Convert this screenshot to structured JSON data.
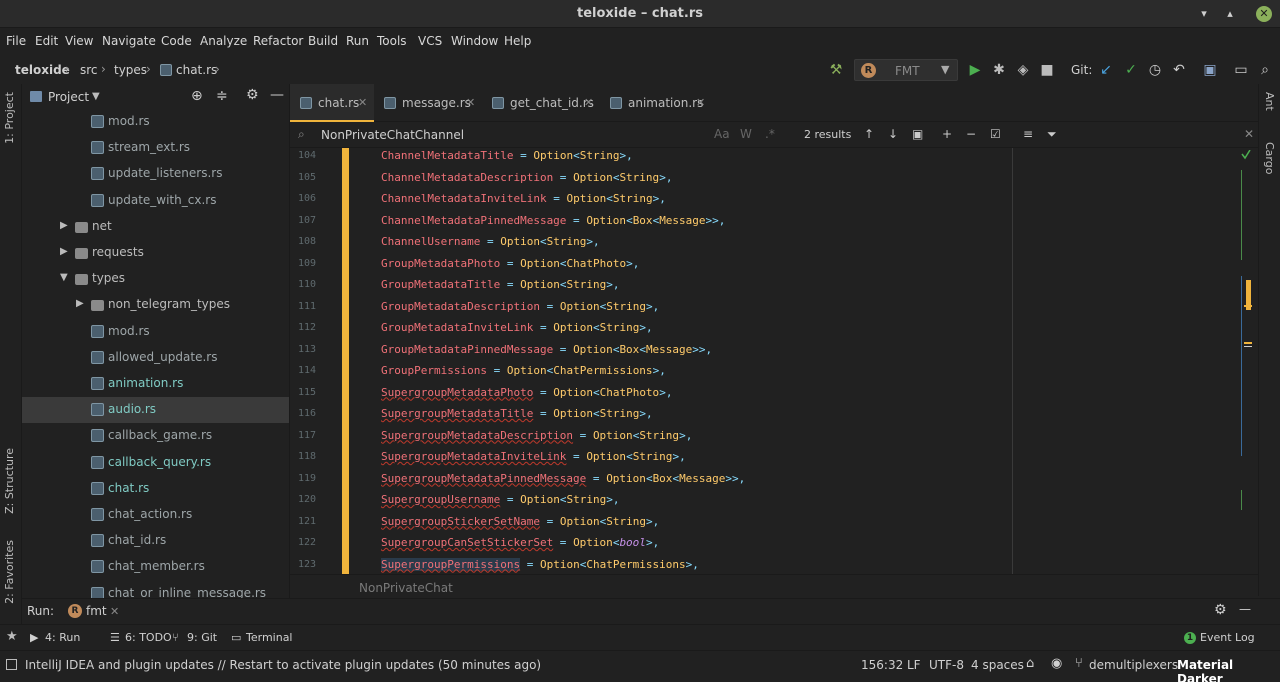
{
  "window": {
    "title": "teloxide – chat.rs"
  },
  "menu": [
    "File",
    "Edit",
    "View",
    "Navigate",
    "Code",
    "Analyze",
    "Refactor",
    "Build",
    "Run",
    "Tools",
    "VCS",
    "Window",
    "Help"
  ],
  "breadcrumb": [
    "teloxide",
    "src",
    "types",
    "chat.rs"
  ],
  "toolbar": {
    "run_config": "FMT",
    "git_label": "Git:"
  },
  "side_tabs": {
    "project": "1: Project",
    "structure": "Z: Structure",
    "favorites": "2: Favorites",
    "ant": "Ant",
    "cargo": "Cargo"
  },
  "project": {
    "title": "Project",
    "rows": [
      {
        "name": "mod.rs",
        "type": "rs",
        "indent": 4,
        "style": "file"
      },
      {
        "name": "stream_ext.rs",
        "type": "rs",
        "indent": 4,
        "style": "file"
      },
      {
        "name": "update_listeners.rs",
        "type": "rs",
        "indent": 4,
        "style": "file"
      },
      {
        "name": "update_with_cx.rs",
        "type": "rs",
        "indent": 4,
        "style": "file"
      },
      {
        "name": "net",
        "type": "dir",
        "indent": 3,
        "style": "plain",
        "arrow": "▶"
      },
      {
        "name": "requests",
        "type": "dir",
        "indent": 3,
        "style": "plain",
        "arrow": "▶"
      },
      {
        "name": "types",
        "type": "dir",
        "indent": 3,
        "style": "plain",
        "arrow": "▼"
      },
      {
        "name": "non_telegram_types",
        "type": "dir",
        "indent": 4,
        "style": "plain",
        "arrow": "▶"
      },
      {
        "name": "mod.rs",
        "type": "rs",
        "indent": 4,
        "style": "file"
      },
      {
        "name": "allowed_update.rs",
        "type": "rs",
        "indent": 4,
        "style": "file"
      },
      {
        "name": "animation.rs",
        "type": "rs",
        "indent": 4,
        "style": "mod"
      },
      {
        "name": "audio.rs",
        "type": "rs",
        "indent": 4,
        "style": "mod",
        "selected": true
      },
      {
        "name": "callback_game.rs",
        "type": "rs",
        "indent": 4,
        "style": "file"
      },
      {
        "name": "callback_query.rs",
        "type": "rs",
        "indent": 4,
        "style": "mod"
      },
      {
        "name": "chat.rs",
        "type": "rs",
        "indent": 4,
        "style": "mod"
      },
      {
        "name": "chat_action.rs",
        "type": "rs",
        "indent": 4,
        "style": "file"
      },
      {
        "name": "chat_id.rs",
        "type": "rs",
        "indent": 4,
        "style": "file"
      },
      {
        "name": "chat_member.rs",
        "type": "rs",
        "indent": 4,
        "style": "file"
      },
      {
        "name": "chat_or_inline_message.rs",
        "type": "rs",
        "indent": 4,
        "style": "file"
      }
    ]
  },
  "tabs": [
    {
      "label": "chat.rs",
      "active": true
    },
    {
      "label": "message.rs",
      "active": false
    },
    {
      "label": "get_chat_id.rs",
      "active": false
    },
    {
      "label": "animation.rs",
      "active": false
    }
  ],
  "search": {
    "query": "NonPrivateChatChannel",
    "results": "2 results",
    "match_case": "Aa",
    "words": "W"
  },
  "code": [
    {
      "n": "104",
      "name": "ChannelMetadataTitle",
      "type": "Option<String>",
      "squig": false
    },
    {
      "n": "105",
      "name": "ChannelMetadataDescription",
      "type": "Option<String>",
      "squig": false
    },
    {
      "n": "106",
      "name": "ChannelMetadataInviteLink",
      "type": "Option<String>",
      "squig": false
    },
    {
      "n": "107",
      "name": "ChannelMetadataPinnedMessage",
      "type": "Option<Box<Message>>",
      "squig": false
    },
    {
      "n": "108",
      "name": "ChannelUsername",
      "type": "Option<String>",
      "squig": false
    },
    {
      "n": "109",
      "name": "GroupMetadataPhoto",
      "type": "Option<ChatPhoto>",
      "squig": false
    },
    {
      "n": "110",
      "name": "GroupMetadataTitle",
      "type": "Option<String>",
      "squig": false
    },
    {
      "n": "111",
      "name": "GroupMetadataDescription",
      "type": "Option<String>",
      "squig": false
    },
    {
      "n": "112",
      "name": "GroupMetadataInviteLink",
      "type": "Option<String>",
      "squig": false
    },
    {
      "n": "113",
      "name": "GroupMetadataPinnedMessage",
      "type": "Option<Box<Message>>",
      "squig": false
    },
    {
      "n": "114",
      "name": "GroupPermissions",
      "type": "Option<ChatPermissions>",
      "squig": false
    },
    {
      "n": "115",
      "name": "SupergroupMetadataPhoto",
      "type": "Option<ChatPhoto>",
      "squig": true
    },
    {
      "n": "116",
      "name": "SupergroupMetadataTitle",
      "type": "Option<String>",
      "squig": true
    },
    {
      "n": "117",
      "name": "SupergroupMetadataDescription",
      "type": "Option<String>",
      "squig": true
    },
    {
      "n": "118",
      "name": "SupergroupMetadataInviteLink",
      "type": "Option<String>",
      "squig": true
    },
    {
      "n": "119",
      "name": "SupergroupMetadataPinnedMessage",
      "type": "Option<Box<Message>>",
      "squig": true
    },
    {
      "n": "120",
      "name": "SupergroupUsername",
      "type": "Option<String>",
      "squig": true
    },
    {
      "n": "121",
      "name": "SupergroupStickerSetName",
      "type": "Option<String>",
      "squig": true
    },
    {
      "n": "122",
      "name": "SupergroupCanSetStickerSet",
      "type": "Option<bool>",
      "squig": true
    },
    {
      "n": "123",
      "name": "SupergroupPermissions",
      "type": "Option<ChatPermissions>",
      "squig": true
    }
  ],
  "editor_breadcrumb": "NonPrivateChat",
  "run_panel": {
    "label": "Run:",
    "tab": "fmt"
  },
  "tool_windows": [
    {
      "label": "4: Run",
      "active": true
    },
    {
      "label": "6: TODO",
      "active": false
    },
    {
      "label": "9: Git",
      "active": false
    },
    {
      "label": "Terminal",
      "active": false
    }
  ],
  "event_log": "Event Log",
  "status": {
    "message": "IntelliJ IDEA and plugin updates // Restart to activate plugin updates (50 minutes ago)",
    "position": "156:32",
    "line_sep": "LF",
    "encoding": "UTF-8",
    "indent": "4 spaces",
    "user": "demultiplexers",
    "theme": "Material Darker"
  }
}
